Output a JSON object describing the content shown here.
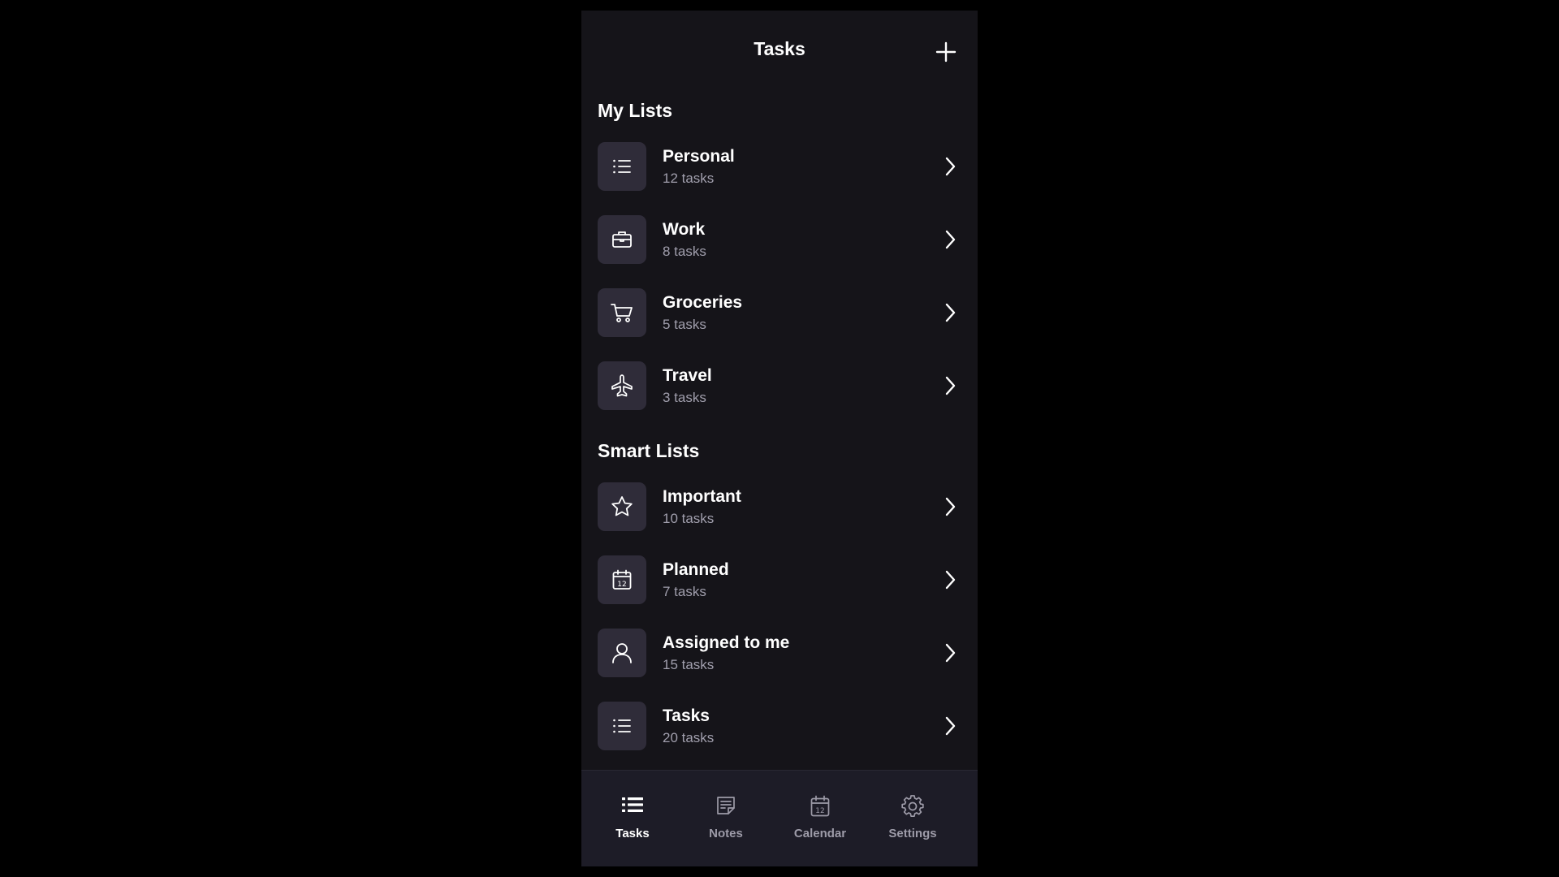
{
  "header": {
    "title": "Tasks",
    "add_icon": "plus-icon"
  },
  "my_lists": {
    "title": "My Lists",
    "items": [
      {
        "label": "Personal",
        "count": "12 tasks",
        "icon": "list-icon"
      },
      {
        "label": "Work",
        "count": "8 tasks",
        "icon": "briefcase-icon"
      },
      {
        "label": "Groceries",
        "count": "5 tasks",
        "icon": "cart-icon"
      },
      {
        "label": "Travel",
        "count": "3 tasks",
        "icon": "airplane-icon"
      }
    ]
  },
  "smart_lists": {
    "title": "Smart Lists",
    "items": [
      {
        "label": "Important",
        "count": "10 tasks",
        "icon": "star-icon"
      },
      {
        "label": "Planned",
        "count": "7 tasks",
        "icon": "calendar-icon"
      },
      {
        "label": "Assigned to me",
        "count": "15 tasks",
        "icon": "person-icon"
      },
      {
        "label": "Tasks",
        "count": "20 tasks",
        "icon": "list-icon"
      }
    ]
  },
  "tabbar": {
    "active": "Tasks",
    "tabs": [
      {
        "label": "Tasks",
        "icon": "list-icon"
      },
      {
        "label": "Notes",
        "icon": "notes-icon"
      },
      {
        "label": "Calendar",
        "icon": "calendar-icon"
      },
      {
        "label": "Settings",
        "icon": "gear-icon"
      }
    ]
  },
  "colors": {
    "background": "#000000",
    "surface": "#151419",
    "icon_box": "#2f2c39",
    "tabbar": "#1d1c27",
    "secondary_text": "#a19fad",
    "inactive_tab": "#9d9ba8"
  }
}
